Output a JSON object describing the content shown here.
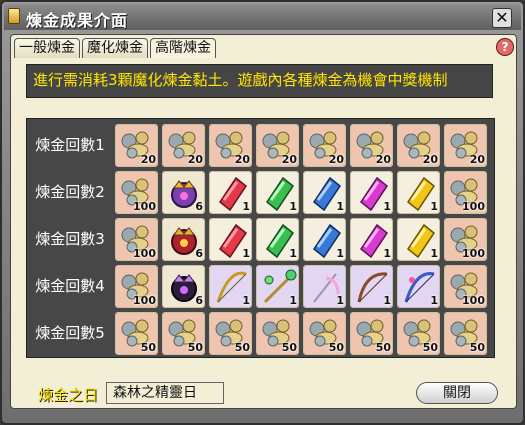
{
  "window": {
    "title": "煉金成果介面",
    "close_icon": "close-icon"
  },
  "tabs": [
    {
      "label": "一般煉金",
      "active": false
    },
    {
      "label": "魔化煉金",
      "active": false
    },
    {
      "label": "高階煉金",
      "active": true
    }
  ],
  "help_label": "?",
  "notice": "進行需消耗3顆魔化煉金黏土。遊戲內各種煉金為機會中獎機制",
  "rows": [
    {
      "label": "煉金回數1",
      "slots": [
        {
          "icon": "alchemy-clay",
          "count": "20"
        },
        {
          "icon": "alchemy-clay",
          "count": "20"
        },
        {
          "icon": "alchemy-clay",
          "count": "20"
        },
        {
          "icon": "alchemy-clay",
          "count": "20"
        },
        {
          "icon": "alchemy-clay",
          "count": "20"
        },
        {
          "icon": "alchemy-clay",
          "count": "20"
        },
        {
          "icon": "alchemy-clay",
          "count": "20"
        },
        {
          "icon": "alchemy-clay",
          "count": "20"
        }
      ]
    },
    {
      "label": "煉金回數2",
      "slots": [
        {
          "icon": "alchemy-clay",
          "count": "100"
        },
        {
          "icon": "purple-crown",
          "count": "6"
        },
        {
          "icon": "red-crystal",
          "count": "1"
        },
        {
          "icon": "green-crystal",
          "count": "1"
        },
        {
          "icon": "blue-crystal",
          "count": "1"
        },
        {
          "icon": "magenta-crystal",
          "count": "1"
        },
        {
          "icon": "yellow-crystal",
          "count": "1"
        },
        {
          "icon": "alchemy-clay",
          "count": "100"
        }
      ]
    },
    {
      "label": "煉金回數3",
      "slots": [
        {
          "icon": "alchemy-clay",
          "count": "100"
        },
        {
          "icon": "red-crown",
          "count": "6"
        },
        {
          "icon": "red-crystal",
          "count": "1"
        },
        {
          "icon": "green-crystal",
          "count": "1"
        },
        {
          "icon": "blue-crystal",
          "count": "1"
        },
        {
          "icon": "magenta-crystal",
          "count": "1"
        },
        {
          "icon": "yellow-crystal",
          "count": "1"
        },
        {
          "icon": "alchemy-clay",
          "count": "100"
        }
      ]
    },
    {
      "label": "煉金回數4",
      "slots": [
        {
          "icon": "alchemy-clay",
          "count": "100"
        },
        {
          "icon": "dark-crown",
          "count": "6"
        },
        {
          "icon": "golden-bow",
          "count": "1"
        },
        {
          "icon": "green-staff",
          "count": "1"
        },
        {
          "icon": "pink-scythe",
          "count": "1"
        },
        {
          "icon": "brown-bow",
          "count": "1"
        },
        {
          "icon": "blue-bow",
          "count": "1"
        },
        {
          "icon": "alchemy-clay",
          "count": "100"
        }
      ]
    },
    {
      "label": "煉金回數5",
      "slots": [
        {
          "icon": "alchemy-clay",
          "count": "50"
        },
        {
          "icon": "alchemy-clay",
          "count": "50"
        },
        {
          "icon": "alchemy-clay",
          "count": "50"
        },
        {
          "icon": "alchemy-clay",
          "count": "50"
        },
        {
          "icon": "alchemy-clay",
          "count": "50"
        },
        {
          "icon": "alchemy-clay",
          "count": "50"
        },
        {
          "icon": "alchemy-clay",
          "count": "50"
        },
        {
          "icon": "alchemy-clay",
          "count": "50"
        }
      ]
    }
  ],
  "footer": {
    "label": "煉金之日",
    "value": "森林之精靈日",
    "close_button": "關閉"
  }
}
